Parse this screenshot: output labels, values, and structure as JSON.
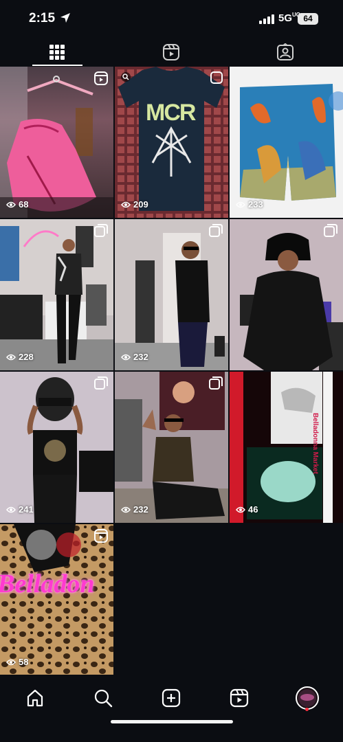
{
  "status_bar": {
    "time": "2:15",
    "network": "5G",
    "network_suffix": "UC",
    "battery": "64"
  },
  "tabs": [
    {
      "name": "grid",
      "icon": "grid-icon",
      "selected": true
    },
    {
      "name": "reels",
      "icon": "reels-icon",
      "selected": false
    },
    {
      "name": "tagged",
      "icon": "tagged-person-icon",
      "selected": false
    }
  ],
  "posts": [
    {
      "views": "68",
      "type": "reel",
      "description": "pink lingerie on hanger"
    },
    {
      "views": "209",
      "type": "photo",
      "overlay_text": "MCR",
      "description": "navy MCR t-shirt"
    },
    {
      "views": "233",
      "type": "photo",
      "description": "tiger dragon print shorts"
    },
    {
      "views": "228",
      "type": "carousel",
      "description": "man in patterned shirt"
    },
    {
      "views": "232",
      "type": "carousel",
      "description": "man in black tee"
    },
    {
      "views": "232",
      "type": "carousel",
      "description": "man in leather jacket"
    },
    {
      "views": "241",
      "type": "carousel",
      "description": "man with helmet"
    },
    {
      "views": "232",
      "type": "carousel",
      "description": "man waving on floor"
    },
    {
      "views": "46",
      "type": "photo",
      "overlay_text": "Belladonna Market",
      "description": "crocs shoes collage"
    },
    {
      "views": "58",
      "type": "reel",
      "overlay_text": "Belladon",
      "description": "leopard print neon sign"
    }
  ],
  "bottom_nav": [
    {
      "name": "home",
      "icon": "home-icon"
    },
    {
      "name": "search",
      "icon": "search-icon"
    },
    {
      "name": "create",
      "icon": "plus-square-icon"
    },
    {
      "name": "reels",
      "icon": "reels-icon"
    },
    {
      "name": "profile",
      "icon": "profile-avatar-icon"
    }
  ],
  "colors": {
    "background": "#0b0d12",
    "notification_dot": "#ff3040",
    "text": "#ffffff"
  }
}
